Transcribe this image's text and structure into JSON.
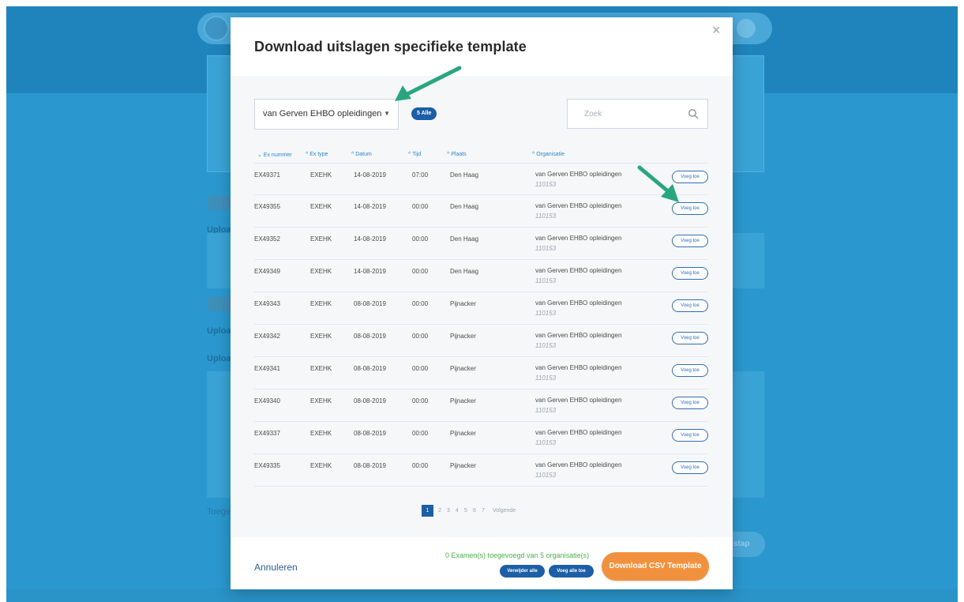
{
  "background": {
    "upload_label": "Uploa",
    "added_label": "Toeges",
    "next_label": "stap"
  },
  "modal": {
    "title": "Download uitslagen specifieke template",
    "close_icon": "×"
  },
  "filters": {
    "organisation_selected": "van Gerven EHBO opleidingen",
    "count_badge": "5 Alle",
    "search_placeholder": "Zoek"
  },
  "columns": {
    "ex_number": "⌄ Ex nummer",
    "ex_type": "^ Ex type",
    "date": "^ Datum",
    "time": "^ Tijd",
    "place": "^ Plaats",
    "organisation": "^ Organisatie"
  },
  "rows": [
    {
      "ex_number": "EX49371",
      "ex_type": "EXEHK",
      "date": "14-08-2019",
      "time": "07:00",
      "place": "Den Haag",
      "organisation": "van Gerven EHBO opleidingen",
      "org_id": "110153",
      "action": "Voeg toe"
    },
    {
      "ex_number": "EX49355",
      "ex_type": "EXEHK",
      "date": "14-08-2019",
      "time": "00:00",
      "place": "Den Haag",
      "organisation": "van Gerven EHBO opleidingen",
      "org_id": "110153",
      "action": "Voeg toe"
    },
    {
      "ex_number": "EX49352",
      "ex_type": "EXEHK",
      "date": "14-08-2019",
      "time": "00:00",
      "place": "Den Haag",
      "organisation": "van Gerven EHBO opleidingen",
      "org_id": "110153",
      "action": "Voeg toe"
    },
    {
      "ex_number": "EX49349",
      "ex_type": "EXEHK",
      "date": "14-08-2019",
      "time": "00:00",
      "place": "Den Haag",
      "organisation": "van Gerven EHBO opleidingen",
      "org_id": "110153",
      "action": "Voeg toe"
    },
    {
      "ex_number": "EX49343",
      "ex_type": "EXEHK",
      "date": "08-08-2019",
      "time": "00:00",
      "place": "Pijnacker",
      "organisation": "van Gerven EHBO opleidingen",
      "org_id": "110153",
      "action": "Voeg toe"
    },
    {
      "ex_number": "EX49342",
      "ex_type": "EXEHK",
      "date": "08-08-2019",
      "time": "00:00",
      "place": "Pijnacker",
      "organisation": "van Gerven EHBO opleidingen",
      "org_id": "110153",
      "action": "Voeg toe"
    },
    {
      "ex_number": "EX49341",
      "ex_type": "EXEHK",
      "date": "08-08-2019",
      "time": "00:00",
      "place": "Pijnacker",
      "organisation": "van Gerven EHBO opleidingen",
      "org_id": "110153",
      "action": "Voeg toe"
    },
    {
      "ex_number": "EX49340",
      "ex_type": "EXEHK",
      "date": "08-08-2019",
      "time": "00:00",
      "place": "Pijnacker",
      "organisation": "van Gerven EHBO opleidingen",
      "org_id": "110153",
      "action": "Voeg toe"
    },
    {
      "ex_number": "EX49337",
      "ex_type": "EXEHK",
      "date": "08-08-2019",
      "time": "00:00",
      "place": "Pijnacker",
      "organisation": "van Gerven EHBO opleidingen",
      "org_id": "110153",
      "action": "Voeg toe"
    },
    {
      "ex_number": "EX49335",
      "ex_type": "EXEHK",
      "date": "08-08-2019",
      "time": "00:00",
      "place": "Pijnacker",
      "organisation": "van Gerven EHBO opleidingen",
      "org_id": "110153",
      "action": "Voeg toe"
    }
  ],
  "pagination": {
    "pages": [
      "1",
      "2",
      "3",
      "4",
      "5",
      "6",
      "7"
    ],
    "current": "1",
    "next_label": "Volgende"
  },
  "footer": {
    "cancel_label": "Annuleren",
    "status": "0 Examen(s) toegevoegd van 5 organisatie(s)",
    "remove_all_label": "Verwijder alle",
    "add_all_label": "Voeg alle toe",
    "download_label": "Download CSV Template"
  },
  "colors": {
    "accent_blue": "#1d5fa6",
    "link_blue": "#2f86c8",
    "download_orange": "#f2913d",
    "status_green": "#4cae4c",
    "annotation_arrow_green": "#2aa67e",
    "background_blue": "#2a98cf"
  },
  "icons": {
    "close": "close-icon",
    "search": "search-icon",
    "dropdown": "caret-down-icon",
    "annotation": "arrow-annotation-icon"
  }
}
